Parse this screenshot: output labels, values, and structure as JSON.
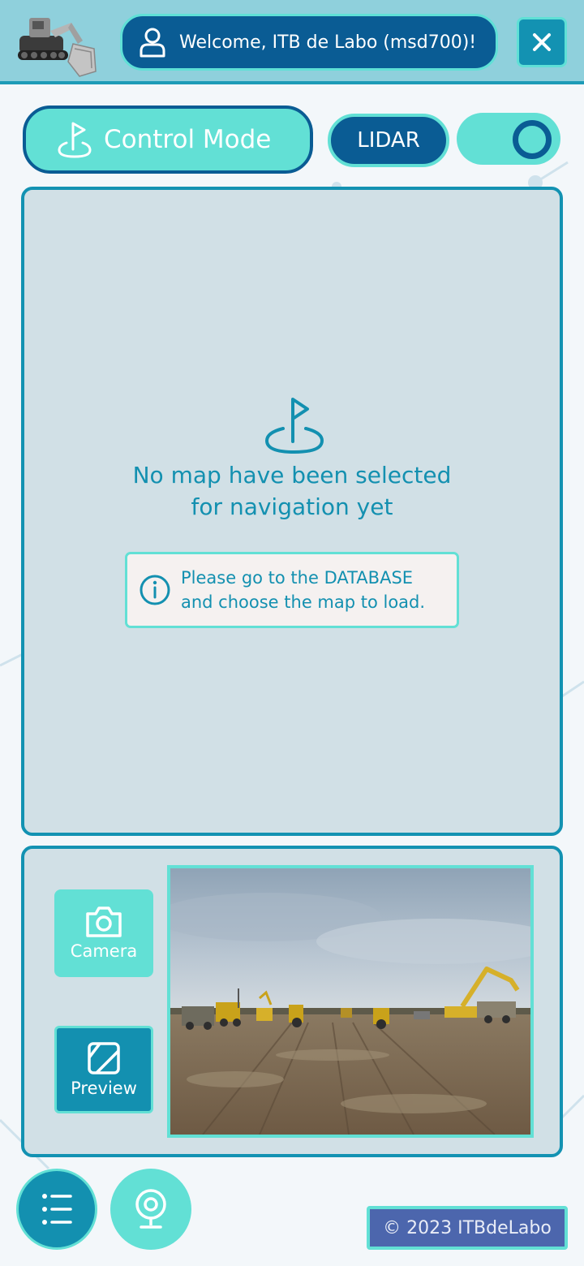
{
  "header": {
    "welcome_text": "Welcome, ITB de Labo (msd700)!"
  },
  "toolbar": {
    "control_mode_label": "Control Mode",
    "lidar_label": "LIDAR",
    "toggle_on": true
  },
  "map_panel": {
    "empty_message_line1": "No map have been selected",
    "empty_message_line2": "for navigation yet",
    "info_line1": "Please go to the DATABASE",
    "info_line2": "and choose the map to load."
  },
  "camera_panel": {
    "camera_label": "Camera",
    "preview_label": "Preview"
  },
  "footer": {
    "copyright": "© 2023 ITBdeLabo"
  },
  "colors": {
    "primary_dark": "#0a5c94",
    "accent_teal": "#62e0d5",
    "primary": "#1390b0",
    "panel_bg": "#d1e0e6",
    "copyright_bg": "#4c66ad"
  },
  "icons": [
    "user-icon",
    "close-icon",
    "flag-icon",
    "info-icon",
    "camera-icon",
    "preview-icon",
    "menu-icon",
    "webcam-icon"
  ]
}
